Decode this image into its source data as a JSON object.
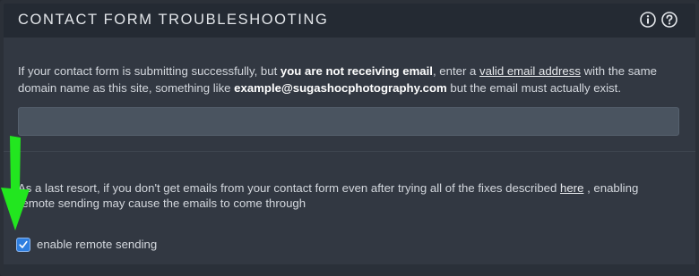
{
  "header": {
    "title": "CONTACT FORM TROUBLESHOOTING",
    "icons": [
      "info-icon",
      "help-icon"
    ]
  },
  "section_email": {
    "line1_pre": "If your contact form is submitting successfully, but ",
    "line1_bold": "you are not receiving email",
    "line1_mid": ", enter a ",
    "line1_link": "valid email address",
    "line1_post": " with the same",
    "line2_pre": "domain name as this site, something like ",
    "line2_bold": "example@sugashocphotography.com",
    "line2_post": " but the email must actually exist.",
    "input_value": "",
    "input_placeholder": ""
  },
  "section_remote": {
    "line1_pre": "As a last resort, if you don't get emails from your contact form even after trying all of the fixes described ",
    "line1_link": "here",
    "line1_post": " , enabling",
    "line2": "remote sending may cause the emails to come through",
    "checkbox_label": "enable remote sending",
    "checkbox_checked": true
  },
  "colors": {
    "header_bg": "#242a33",
    "panel_bg": "#323842",
    "input_bg": "#4a5460",
    "checkbox_accent": "#2f7fe0",
    "annotation_arrow": "#22e61f"
  }
}
